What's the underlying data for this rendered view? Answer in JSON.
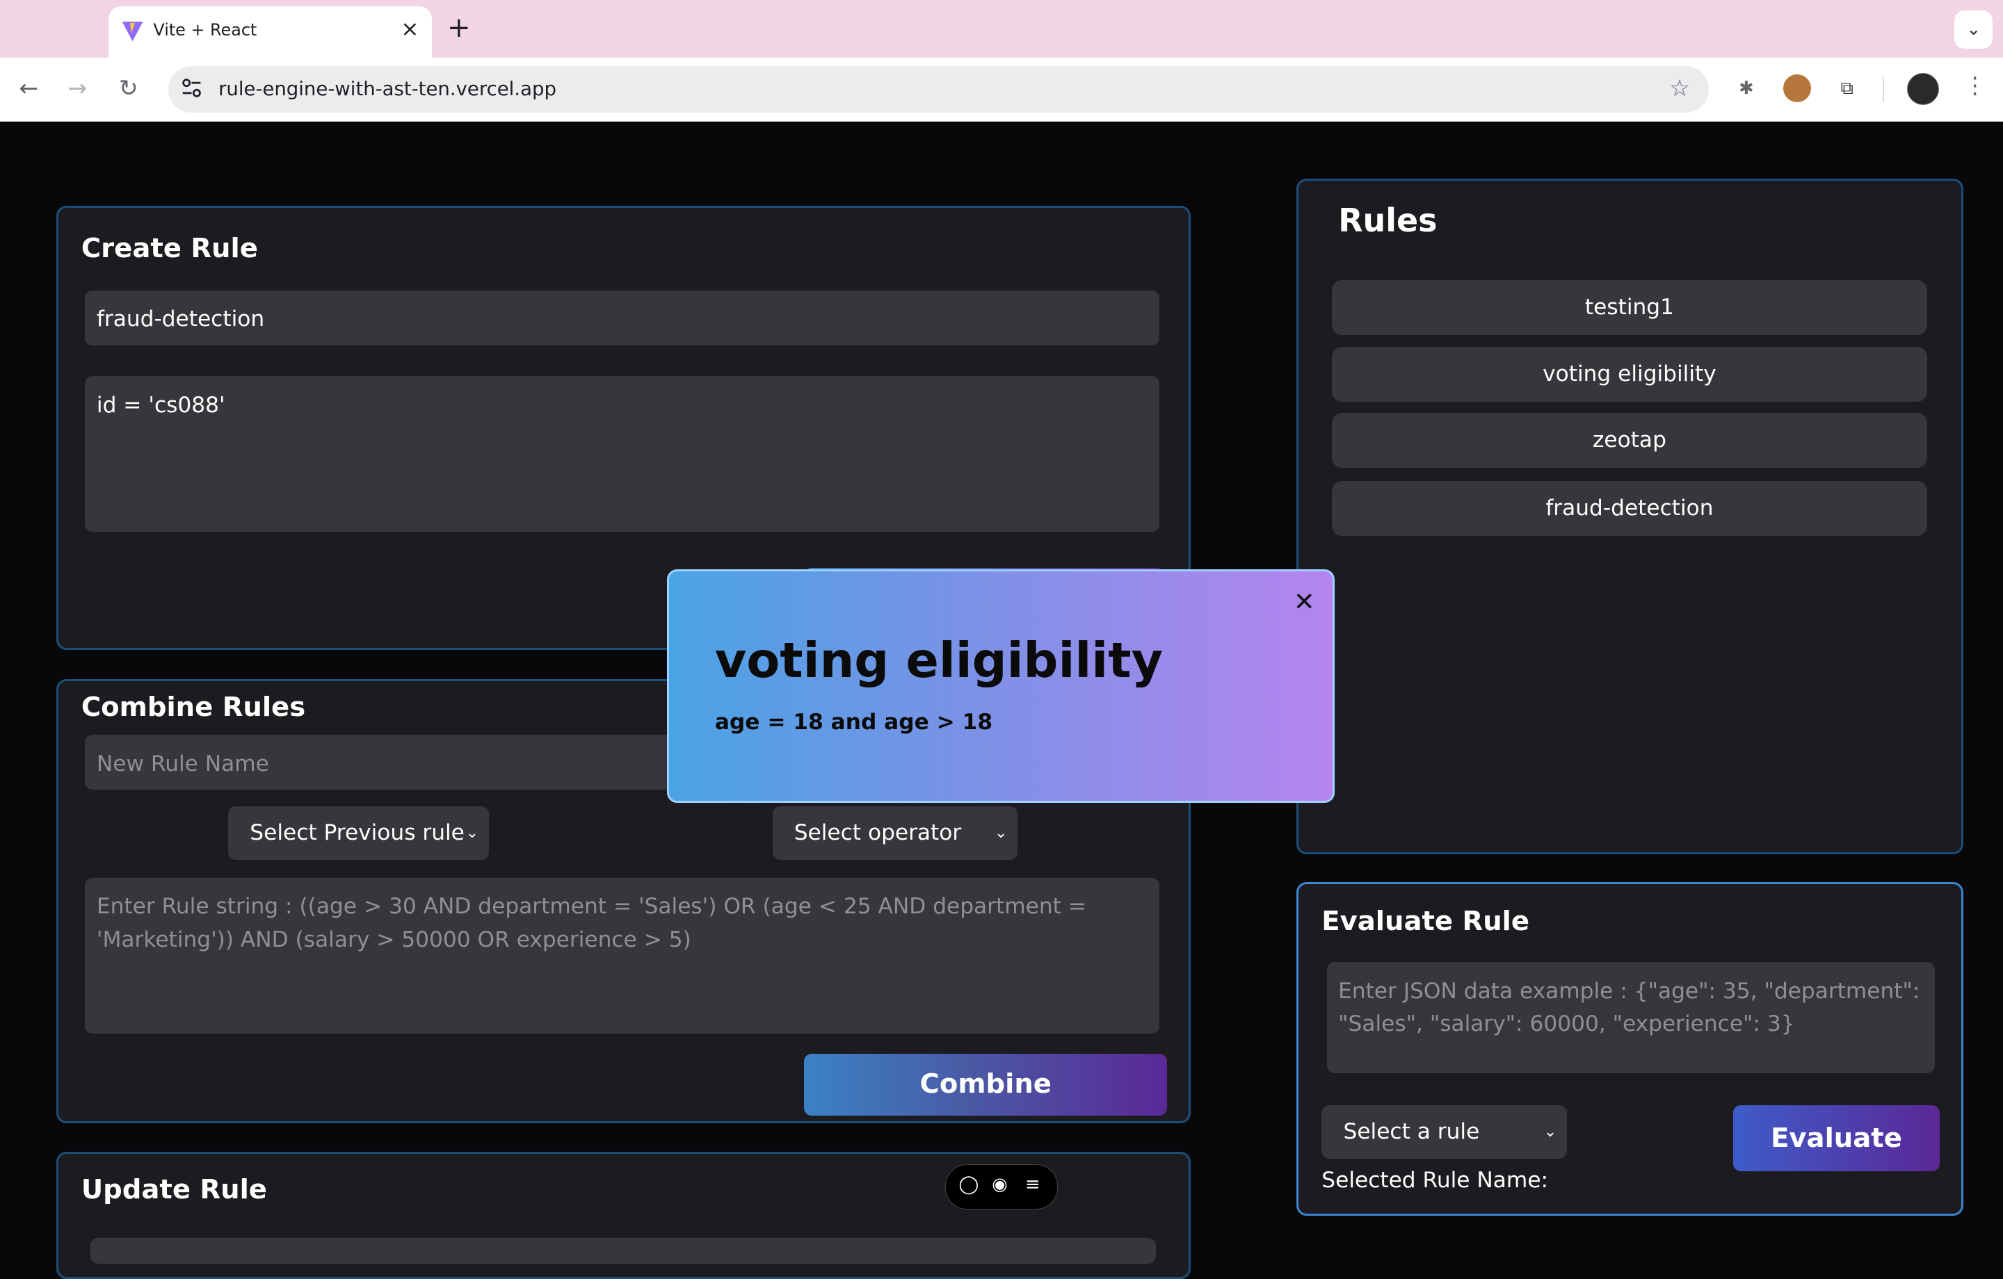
{
  "browser": {
    "tab_title": "Vite + React",
    "url": "rule-engine-with-ast-ten.vercel.app"
  },
  "create_rule": {
    "title": "Create Rule",
    "name_value": "fraud-detection",
    "rule_value": "id = 'cs088'"
  },
  "combine_rules": {
    "title": "Combine Rules",
    "name_placeholder": "New Rule Name",
    "previous_rule_select": "Select Previous rule",
    "operator_select": "Select operator",
    "rule_placeholder": "Enter Rule string : ((age > 30 AND department = 'Sales') OR (age < 25 AND department = 'Marketing')) AND (salary > 50000 OR experience > 5)",
    "combine_label": "Combine"
  },
  "update_rule": {
    "title": "Update Rule"
  },
  "rules": {
    "title": "Rules",
    "items": [
      "testing1",
      "voting eligibility",
      "zeotap",
      "fraud-detection"
    ]
  },
  "evaluate_rule": {
    "title": "Evaluate Rule",
    "json_placeholder": "Enter JSON data example : {\"age\": 35, \"department\": \"Sales\", \"salary\": 60000, \"experience\": 3}",
    "rule_select": "Select a rule",
    "evaluate_label": "Evaluate",
    "selected_label": "Selected Rule Name:"
  },
  "modal": {
    "title": "voting eligibility",
    "body": "age = 18 and age > 18"
  }
}
